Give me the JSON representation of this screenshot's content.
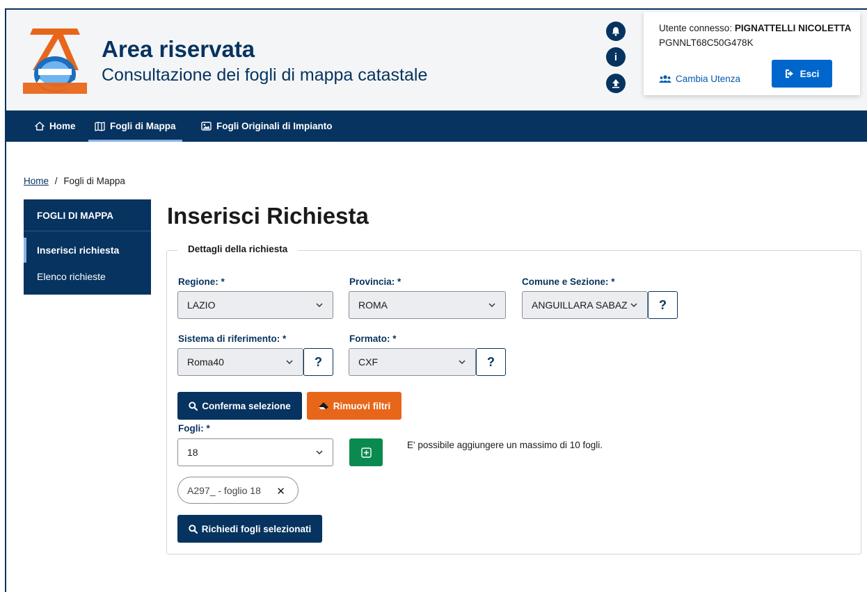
{
  "header": {
    "title": "Area riservata",
    "subtitle": "Consultazione dei fogli di mappa catastale"
  },
  "user": {
    "connected_prefix": "Utente connesso:",
    "name": "PIGNATTELLI NICOLETTA",
    "code": "PGNNLT68C50G478K",
    "switch_label": "Cambia Utenza",
    "logout_label": "Esci"
  },
  "nav": {
    "items": [
      {
        "label": "Home",
        "icon": "home-icon"
      },
      {
        "label": "Fogli di Mappa",
        "icon": "map-icon",
        "active": true
      },
      {
        "label": "Fogli Originali di Impianto",
        "icon": "image-icon"
      }
    ]
  },
  "breadcrumb": {
    "home": "Home",
    "separator": "/",
    "current": "Fogli di Mappa"
  },
  "sidebar": {
    "heading": "FOGLI DI MAPPA",
    "items": [
      {
        "label": "Inserisci richiesta",
        "active": true
      },
      {
        "label": "Elenco richieste",
        "active": false
      }
    ]
  },
  "page": {
    "title": "Inserisci Richiesta",
    "legend": "Dettagli della richiesta"
  },
  "form": {
    "regione": {
      "label": "Regione: *",
      "value": "LAZIO"
    },
    "provincia": {
      "label": "Provincia: *",
      "value": "ROMA"
    },
    "comune": {
      "label": "Comune e Sezione: *",
      "value": "ANGUILLARA SABAZIO"
    },
    "sistema": {
      "label": "Sistema di riferimento: *",
      "value": "Roma40"
    },
    "formato": {
      "label": "Formato: *",
      "value": "CXF"
    },
    "help_label": "?",
    "confirm_label": "Conferma selezione",
    "remove_label": "Rimuovi filtri",
    "fogli": {
      "label": "Fogli: *",
      "value": "18"
    },
    "hint": "E' possibile aggiungere un massimo di 10 fogli.",
    "selected_chip": "A297_ - foglio 18",
    "request_label": "Richiedi fogli selezionati"
  },
  "colors": {
    "brand": "#06335f",
    "accent_blue": "#0066cc",
    "orange": "#e8661a",
    "green": "#0a8a4f"
  }
}
